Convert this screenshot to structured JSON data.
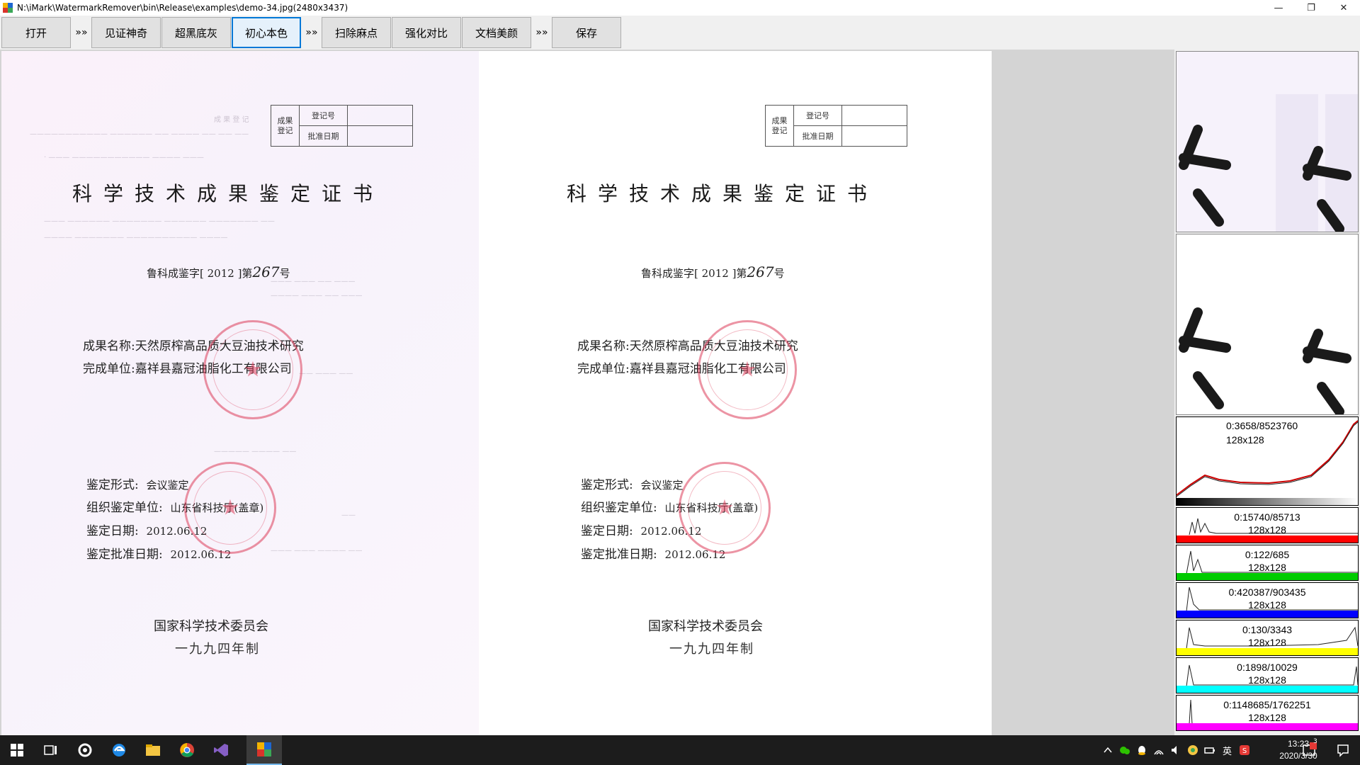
{
  "window": {
    "title": "N:\\iMark\\WatermarkRemover\\bin\\Release\\examples\\demo-34.jpg(2480x3437)",
    "controls": {
      "minimize": "—",
      "restore": "❐",
      "close": "✕"
    }
  },
  "toolbar": {
    "open_label": "打开",
    "sep1": "»»",
    "witness_label": "见证神奇",
    "black_gray_label": "超黑底灰",
    "original_color_label": "初心本色",
    "sep2": "»»",
    "remove_spots_label": "扫除麻点",
    "enhance_contrast_label": "强化对比",
    "doc_beauty_label": "文档美颜",
    "sep3": "»»",
    "save_label": "保存",
    "active": "初心本色"
  },
  "document": {
    "reg_box": {
      "col1": "成果\n登记",
      "row1": "登记号",
      "row2": "批准日期"
    },
    "title": "科学技术成果鉴定证书",
    "number_prefix": "鲁科成鉴字[ 2012 ]第",
    "number_hand": "267",
    "number_suffix": "号",
    "name_label": "成果名称:",
    "name_value": "天然原榨高品质大豆油技术研究",
    "unit_label": "完成单位:",
    "unit_value": "嘉祥县嘉冠油脂化工有限公司",
    "form_label": "鉴定形式:",
    "form_value": "会议鉴定",
    "org_label": "组织鉴定单位:",
    "org_value": "山东省科技厅(盖章)",
    "date_label": "鉴定日期:",
    "date_value": "2012.06.12",
    "approve_label": "鉴定批准日期:",
    "approve_value": "2012.06.12",
    "committee": "国家科学技术委员会",
    "made": "一九九四年制"
  },
  "histograms": [
    {
      "line1": "0:3658/8523760",
      "line2": "128x128",
      "color": "#000000"
    },
    {
      "line1": "0:15740/85713",
      "line2": "128x128",
      "color": "#ff0000"
    },
    {
      "line1": "0:122/685",
      "line2": "128x128",
      "color": "#00cc00"
    },
    {
      "line1": "0:420387/903435",
      "line2": "128x128",
      "color": "#0000ff"
    },
    {
      "line1": "0:130/3343",
      "line2": "128x128",
      "color": "#ffff00"
    },
    {
      "line1": "0:1898/10029",
      "line2": "128x128",
      "color": "#00ffff"
    },
    {
      "line1": "0:1148685/1762251",
      "line2": "128x128",
      "color": "#ff00ff"
    }
  ],
  "taskbar": {
    "icons": [
      "windows-start-icon",
      "task-view-icon",
      "settings-app-icon",
      "edge-icon",
      "file-explorer-icon",
      "chrome-icon",
      "visual-studio-icon",
      "watermark-remover-app-icon"
    ],
    "ime": "英",
    "time": "13:23",
    "date": "2020/3/30",
    "notif_count": "3"
  }
}
